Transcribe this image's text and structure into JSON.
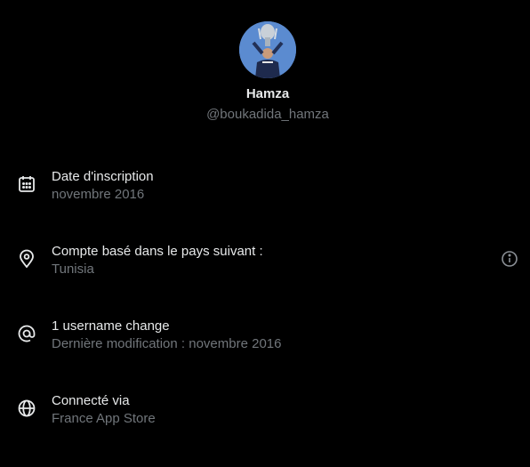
{
  "profile": {
    "name": "Hamza",
    "handle": "@boukadida_hamza"
  },
  "rows": [
    {
      "title": "Date d'inscription",
      "subtitle": "novembre 2016",
      "icon": "calendar-icon"
    },
    {
      "title": "Compte basé dans le pays suivant :",
      "subtitle": "Tunisia",
      "icon": "location-pin-icon",
      "action_icon": "info-icon"
    },
    {
      "title": "1 username change",
      "subtitle": "Dernière modification : novembre 2016",
      "icon": "at-sign-icon"
    },
    {
      "title": "Connecté via",
      "subtitle": "France App Store",
      "icon": "globe-icon"
    }
  ],
  "colors": {
    "background": "#000000",
    "primary_text": "#e7e9ea",
    "secondary_text": "#71767b"
  }
}
